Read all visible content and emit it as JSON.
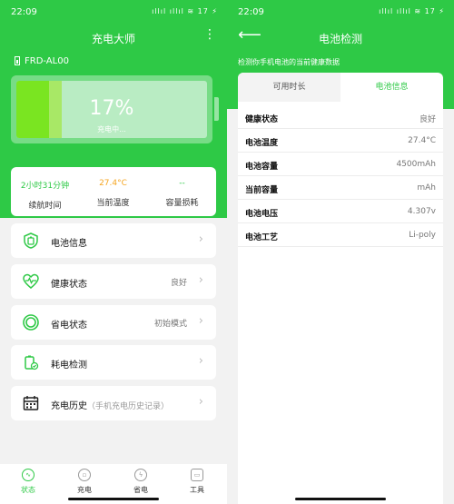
{
  "status_bar": {
    "time": "22:09",
    "icons": "ıllıl ıllıl ≋ 17 ⚡"
  },
  "screen1": {
    "title": "充电大师",
    "device": "FRD-AL00",
    "battery": {
      "percent_text": "17%",
      "status": "充电中...",
      "level_fraction": 0.17
    },
    "stats": [
      {
        "value": "2小时31分钟",
        "label": "续航时间",
        "color": "#2ec946"
      },
      {
        "value": "27.4°C",
        "label": "当前温度",
        "color": "#f5a623"
      },
      {
        "value": "--",
        "label": "容量损耗",
        "color": "#2ec946"
      }
    ],
    "menu": [
      {
        "label": "电池信息",
        "value": "",
        "sub": "",
        "icon": "battery-shield-icon"
      },
      {
        "label": "健康状态",
        "value": "良好",
        "sub": "",
        "icon": "heart-pulse-icon"
      },
      {
        "label": "省电状态",
        "value": "初始模式",
        "sub": "",
        "icon": "power-ring-icon"
      },
      {
        "label": "耗电检测",
        "value": "",
        "sub": "",
        "icon": "battery-check-icon"
      },
      {
        "label": "充电历史",
        "value": "",
        "sub": "（手机充电历史记录）",
        "icon": "calendar-icon"
      }
    ],
    "tabs": [
      "状态",
      "充电",
      "省电",
      "工具"
    ]
  },
  "screen2": {
    "title": "电池检测",
    "desc": "检测你手机电池的当前健康数据",
    "tabs": [
      "可用时长",
      "电池信息"
    ],
    "rows": [
      {
        "key": "健康状态",
        "value": "良好"
      },
      {
        "key": "电池温度",
        "value": "27.4°C"
      },
      {
        "key": "电池容量",
        "value": "4500mAh"
      },
      {
        "key": "当前容量",
        "value": "mAh"
      },
      {
        "key": "电池电压",
        "value": "4.307v"
      },
      {
        "key": "电池工艺",
        "value": "Li-poly"
      }
    ]
  },
  "colors": {
    "accent": "#2ec946",
    "warm": "#f5a623"
  }
}
